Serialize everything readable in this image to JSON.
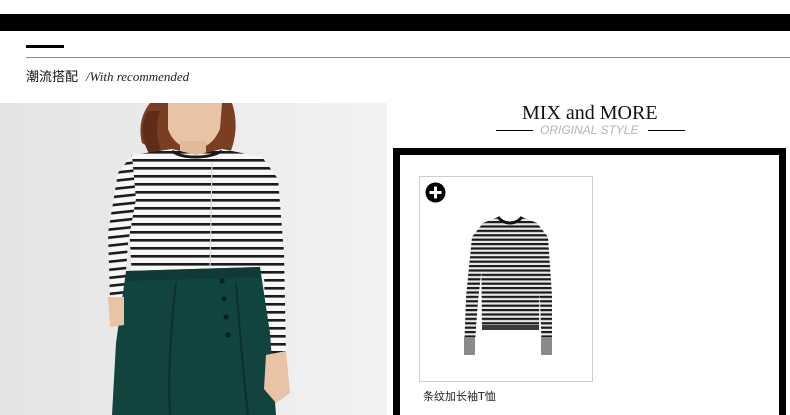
{
  "section": {
    "title_cn": "潮流搭配",
    "title_en": "/With recommended"
  },
  "mix": {
    "title": "MIX and MORE",
    "subtitle": "ORIGINAL STYLE"
  },
  "product": {
    "name": "条纹加长袖T恤",
    "add_icon": "plus-circle-icon"
  },
  "colors": {
    "bar": "#000000",
    "subtitle_gray": "#b5b5b5",
    "skirt_teal": "#12443f",
    "background": "#ffffff"
  }
}
